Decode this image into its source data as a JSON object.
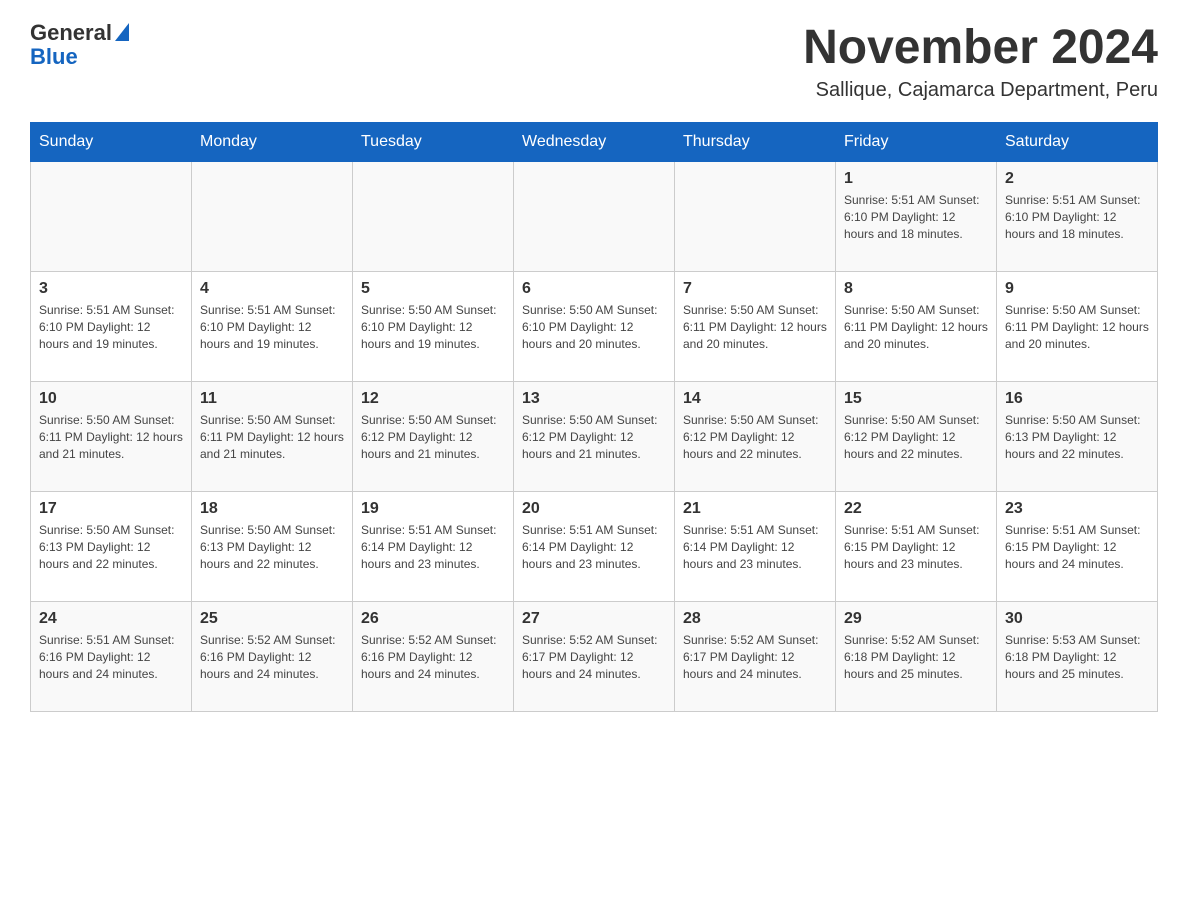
{
  "header": {
    "logo_general": "General",
    "logo_blue": "Blue",
    "month_title": "November 2024",
    "location": "Sallique, Cajamarca Department, Peru"
  },
  "days_of_week": [
    "Sunday",
    "Monday",
    "Tuesday",
    "Wednesday",
    "Thursday",
    "Friday",
    "Saturday"
  ],
  "weeks": [
    [
      {
        "day": "",
        "info": ""
      },
      {
        "day": "",
        "info": ""
      },
      {
        "day": "",
        "info": ""
      },
      {
        "day": "",
        "info": ""
      },
      {
        "day": "",
        "info": ""
      },
      {
        "day": "1",
        "info": "Sunrise: 5:51 AM\nSunset: 6:10 PM\nDaylight: 12 hours and 18 minutes."
      },
      {
        "day": "2",
        "info": "Sunrise: 5:51 AM\nSunset: 6:10 PM\nDaylight: 12 hours and 18 minutes."
      }
    ],
    [
      {
        "day": "3",
        "info": "Sunrise: 5:51 AM\nSunset: 6:10 PM\nDaylight: 12 hours and 19 minutes."
      },
      {
        "day": "4",
        "info": "Sunrise: 5:51 AM\nSunset: 6:10 PM\nDaylight: 12 hours and 19 minutes."
      },
      {
        "day": "5",
        "info": "Sunrise: 5:50 AM\nSunset: 6:10 PM\nDaylight: 12 hours and 19 minutes."
      },
      {
        "day": "6",
        "info": "Sunrise: 5:50 AM\nSunset: 6:10 PM\nDaylight: 12 hours and 20 minutes."
      },
      {
        "day": "7",
        "info": "Sunrise: 5:50 AM\nSunset: 6:11 PM\nDaylight: 12 hours and 20 minutes."
      },
      {
        "day": "8",
        "info": "Sunrise: 5:50 AM\nSunset: 6:11 PM\nDaylight: 12 hours and 20 minutes."
      },
      {
        "day": "9",
        "info": "Sunrise: 5:50 AM\nSunset: 6:11 PM\nDaylight: 12 hours and 20 minutes."
      }
    ],
    [
      {
        "day": "10",
        "info": "Sunrise: 5:50 AM\nSunset: 6:11 PM\nDaylight: 12 hours and 21 minutes."
      },
      {
        "day": "11",
        "info": "Sunrise: 5:50 AM\nSunset: 6:11 PM\nDaylight: 12 hours and 21 minutes."
      },
      {
        "day": "12",
        "info": "Sunrise: 5:50 AM\nSunset: 6:12 PM\nDaylight: 12 hours and 21 minutes."
      },
      {
        "day": "13",
        "info": "Sunrise: 5:50 AM\nSunset: 6:12 PM\nDaylight: 12 hours and 21 minutes."
      },
      {
        "day": "14",
        "info": "Sunrise: 5:50 AM\nSunset: 6:12 PM\nDaylight: 12 hours and 22 minutes."
      },
      {
        "day": "15",
        "info": "Sunrise: 5:50 AM\nSunset: 6:12 PM\nDaylight: 12 hours and 22 minutes."
      },
      {
        "day": "16",
        "info": "Sunrise: 5:50 AM\nSunset: 6:13 PM\nDaylight: 12 hours and 22 minutes."
      }
    ],
    [
      {
        "day": "17",
        "info": "Sunrise: 5:50 AM\nSunset: 6:13 PM\nDaylight: 12 hours and 22 minutes."
      },
      {
        "day": "18",
        "info": "Sunrise: 5:50 AM\nSunset: 6:13 PM\nDaylight: 12 hours and 22 minutes."
      },
      {
        "day": "19",
        "info": "Sunrise: 5:51 AM\nSunset: 6:14 PM\nDaylight: 12 hours and 23 minutes."
      },
      {
        "day": "20",
        "info": "Sunrise: 5:51 AM\nSunset: 6:14 PM\nDaylight: 12 hours and 23 minutes."
      },
      {
        "day": "21",
        "info": "Sunrise: 5:51 AM\nSunset: 6:14 PM\nDaylight: 12 hours and 23 minutes."
      },
      {
        "day": "22",
        "info": "Sunrise: 5:51 AM\nSunset: 6:15 PM\nDaylight: 12 hours and 23 minutes."
      },
      {
        "day": "23",
        "info": "Sunrise: 5:51 AM\nSunset: 6:15 PM\nDaylight: 12 hours and 24 minutes."
      }
    ],
    [
      {
        "day": "24",
        "info": "Sunrise: 5:51 AM\nSunset: 6:16 PM\nDaylight: 12 hours and 24 minutes."
      },
      {
        "day": "25",
        "info": "Sunrise: 5:52 AM\nSunset: 6:16 PM\nDaylight: 12 hours and 24 minutes."
      },
      {
        "day": "26",
        "info": "Sunrise: 5:52 AM\nSunset: 6:16 PM\nDaylight: 12 hours and 24 minutes."
      },
      {
        "day": "27",
        "info": "Sunrise: 5:52 AM\nSunset: 6:17 PM\nDaylight: 12 hours and 24 minutes."
      },
      {
        "day": "28",
        "info": "Sunrise: 5:52 AM\nSunset: 6:17 PM\nDaylight: 12 hours and 24 minutes."
      },
      {
        "day": "29",
        "info": "Sunrise: 5:52 AM\nSunset: 6:18 PM\nDaylight: 12 hours and 25 minutes."
      },
      {
        "day": "30",
        "info": "Sunrise: 5:53 AM\nSunset: 6:18 PM\nDaylight: 12 hours and 25 minutes."
      }
    ]
  ]
}
